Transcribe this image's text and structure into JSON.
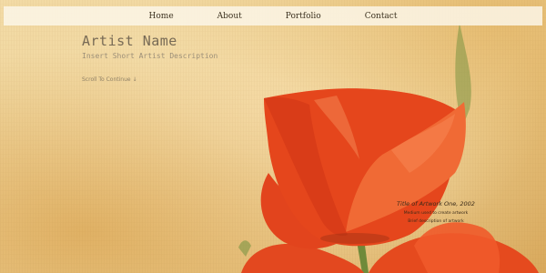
{
  "nav": {
    "items": [
      {
        "label": "Home"
      },
      {
        "label": "About"
      },
      {
        "label": "Portfolio"
      },
      {
        "label": "Contact"
      }
    ]
  },
  "hero": {
    "artist_name": "Artist Name",
    "artist_description": "Insert Short Artist Description",
    "scroll_label": "Scroll To Continue ↓"
  },
  "artwork_caption": {
    "title": "Title of Artwork One, 2002",
    "line1": "Medium used to create artwork",
    "line2": "Brief description of artwork"
  },
  "colors": {
    "background": "#ecd195",
    "flower": "#e8441c",
    "flower_light": "#f2683a",
    "stem": "#6f8a3a"
  }
}
